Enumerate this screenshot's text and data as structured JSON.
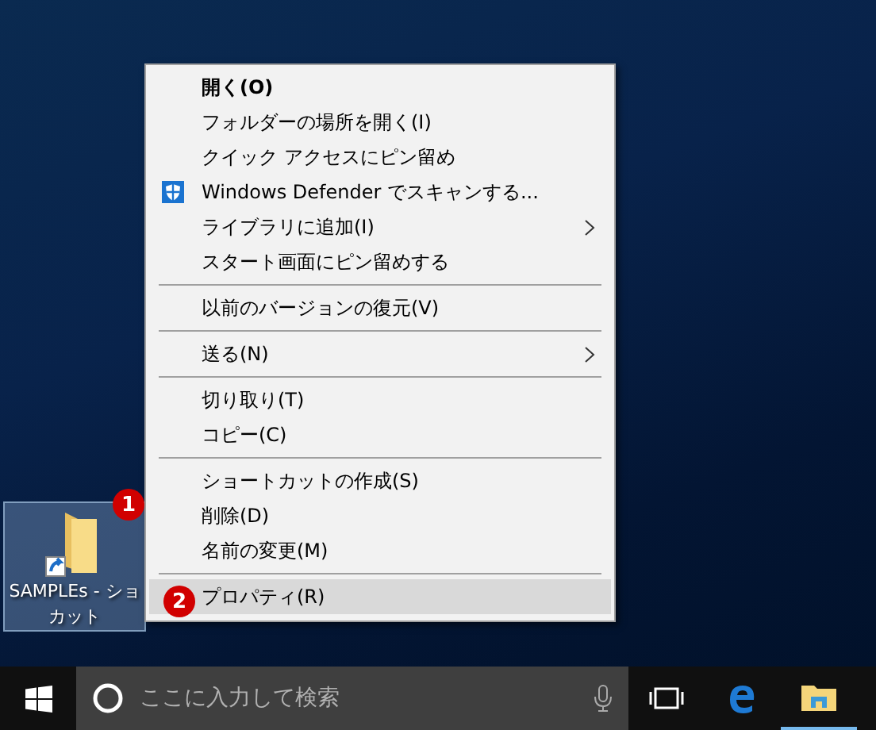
{
  "context_menu": {
    "groups": [
      [
        {
          "label": "開く(O)",
          "bold": true,
          "submenu": false,
          "selected": false
        },
        {
          "label": "フォルダーの場所を開く(I)",
          "bold": false,
          "submenu": false,
          "selected": false
        },
        {
          "label": "クイック アクセスにピン留め",
          "bold": false,
          "submenu": false,
          "selected": false
        },
        {
          "label": "Windows Defender でスキャンする...",
          "bold": false,
          "kind": "scan",
          "submenu": false,
          "selected": false
        },
        {
          "label": "ライブラリに追加(I)",
          "bold": false,
          "submenu": true,
          "selected": false
        },
        {
          "label": "スタート画面にピン留めする",
          "bold": false,
          "submenu": false,
          "selected": false
        }
      ],
      [
        {
          "label": "以前のバージョンの復元(V)",
          "bold": false,
          "submenu": false,
          "selected": false
        }
      ],
      [
        {
          "label": "送る(N)",
          "bold": false,
          "submenu": true,
          "selected": false
        }
      ],
      [
        {
          "label": "切り取り(T)",
          "bold": false,
          "submenu": false,
          "selected": false
        },
        {
          "label": "コピー(C)",
          "bold": false,
          "submenu": false,
          "selected": false
        }
      ],
      [
        {
          "label": "ショートカットの作成(S)",
          "bold": false,
          "submenu": false,
          "selected": false
        },
        {
          "label": "削除(D)",
          "bold": false,
          "submenu": false,
          "selected": false
        },
        {
          "label": "名前の変更(M)",
          "bold": false,
          "submenu": false,
          "selected": false
        }
      ],
      [
        {
          "label": "プロパティ(R)",
          "bold": false,
          "submenu": false,
          "selected": true
        }
      ]
    ]
  },
  "desktop_icon": {
    "label_lines": [
      "SAMPLEs - ショ",
      "カット"
    ],
    "selected": true
  },
  "annotations": [
    "1",
    "2"
  ],
  "taskbar": {
    "search": {
      "placeholder": "ここに入力して検索"
    }
  }
}
